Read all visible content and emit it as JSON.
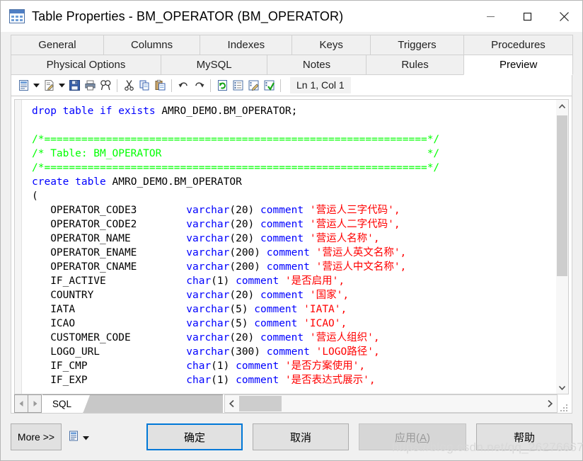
{
  "window": {
    "title": "Table Properties - BM_OPERATOR (BM_OPERATOR)",
    "icon": "table-icon",
    "controls": {
      "minimize": "minimize-icon",
      "maximize": "maximize-icon",
      "close": "close-icon"
    }
  },
  "tabs_row1": [
    {
      "label": "General",
      "active": false
    },
    {
      "label": "Columns",
      "active": false
    },
    {
      "label": "Indexes",
      "active": false
    },
    {
      "label": "Keys",
      "active": false
    },
    {
      "label": "Triggers",
      "active": false
    },
    {
      "label": "Procedures",
      "active": false
    }
  ],
  "tabs_row2": [
    {
      "label": "Physical Options",
      "active": false
    },
    {
      "label": "MySQL",
      "active": false
    },
    {
      "label": "Notes",
      "active": false
    },
    {
      "label": "Rules",
      "active": false
    },
    {
      "label": "Preview",
      "active": true
    }
  ],
  "toolbar": {
    "items": [
      {
        "name": "print-preview-icon",
        "type": "icon"
      },
      {
        "name": "print-preview-dropdown-icon",
        "type": "arrow"
      },
      {
        "name": "edit-document-icon",
        "type": "icon"
      },
      {
        "name": "edit-document-dropdown-icon",
        "type": "arrow"
      },
      {
        "name": "save-icon",
        "type": "icon"
      },
      {
        "name": "print-icon",
        "type": "icon"
      },
      {
        "name": "find-icon",
        "type": "icon"
      },
      {
        "name": "separator",
        "type": "sep"
      },
      {
        "name": "cut-icon",
        "type": "icon"
      },
      {
        "name": "copy-icon",
        "type": "icon"
      },
      {
        "name": "paste-icon",
        "type": "icon"
      },
      {
        "name": "separator",
        "type": "sep"
      },
      {
        "name": "undo-icon",
        "type": "icon"
      },
      {
        "name": "redo-icon",
        "type": "icon"
      },
      {
        "name": "separator",
        "type": "sep"
      },
      {
        "name": "refresh-icon",
        "type": "icon"
      },
      {
        "name": "list-view-icon",
        "type": "icon"
      },
      {
        "name": "edit-script-icon",
        "type": "icon"
      },
      {
        "name": "validate-script-icon",
        "type": "icon"
      },
      {
        "name": "separator",
        "type": "sep"
      }
    ],
    "cursor_position": "Ln 1, Col 1"
  },
  "editor": {
    "language": "SQL",
    "bottom_tab": "SQL",
    "nav_prev": "prev-sheet-icon",
    "nav_next": "next-sheet-icon",
    "code_lines": [
      [
        {
          "t": "drop table if exists ",
          "c": "k"
        },
        {
          "t": "AMRO_DEMO.BM_OPERATOR;",
          "c": "id"
        }
      ],
      [],
      [
        {
          "t": "/*==============================================================*/",
          "c": "cm"
        }
      ],
      [
        {
          "t": "/* Table: BM_OPERATOR                                           */",
          "c": "cm"
        }
      ],
      [
        {
          "t": "/*==============================================================*/",
          "c": "cm"
        }
      ],
      [
        {
          "t": "create table ",
          "c": "k"
        },
        {
          "t": "AMRO_DEMO.BM_OPERATOR",
          "c": "id"
        }
      ],
      [
        {
          "t": "(",
          "c": "id"
        }
      ],
      [
        {
          "t": "   OPERATOR_CODE3        ",
          "c": "id"
        },
        {
          "t": "varchar",
          "c": "k"
        },
        {
          "t": "(20) ",
          "c": "id"
        },
        {
          "t": "comment ",
          "c": "k"
        },
        {
          "t": "'营运人三字代码',",
          "c": "str"
        }
      ],
      [
        {
          "t": "   OPERATOR_CODE2        ",
          "c": "id"
        },
        {
          "t": "varchar",
          "c": "k"
        },
        {
          "t": "(20) ",
          "c": "id"
        },
        {
          "t": "comment ",
          "c": "k"
        },
        {
          "t": "'营运人二字代码',",
          "c": "str"
        }
      ],
      [
        {
          "t": "   OPERATOR_NAME         ",
          "c": "id"
        },
        {
          "t": "varchar",
          "c": "k"
        },
        {
          "t": "(20) ",
          "c": "id"
        },
        {
          "t": "comment ",
          "c": "k"
        },
        {
          "t": "'营运人名称',",
          "c": "str"
        }
      ],
      [
        {
          "t": "   OPERATOR_ENAME        ",
          "c": "id"
        },
        {
          "t": "varchar",
          "c": "k"
        },
        {
          "t": "(200) ",
          "c": "id"
        },
        {
          "t": "comment ",
          "c": "k"
        },
        {
          "t": "'营运人英文名称',",
          "c": "str"
        }
      ],
      [
        {
          "t": "   OPERATOR_CNAME        ",
          "c": "id"
        },
        {
          "t": "varchar",
          "c": "k"
        },
        {
          "t": "(200) ",
          "c": "id"
        },
        {
          "t": "comment ",
          "c": "k"
        },
        {
          "t": "'营运人中文名称',",
          "c": "str"
        }
      ],
      [
        {
          "t": "   IF_ACTIVE             ",
          "c": "id"
        },
        {
          "t": "char",
          "c": "k"
        },
        {
          "t": "(1) ",
          "c": "id"
        },
        {
          "t": "comment ",
          "c": "k"
        },
        {
          "t": "'是否启用',",
          "c": "str"
        }
      ],
      [
        {
          "t": "   COUNTRY               ",
          "c": "id"
        },
        {
          "t": "varchar",
          "c": "k"
        },
        {
          "t": "(20) ",
          "c": "id"
        },
        {
          "t": "comment ",
          "c": "k"
        },
        {
          "t": "'国家',",
          "c": "str"
        }
      ],
      [
        {
          "t": "   IATA                  ",
          "c": "id"
        },
        {
          "t": "varchar",
          "c": "k"
        },
        {
          "t": "(5) ",
          "c": "id"
        },
        {
          "t": "comment ",
          "c": "k"
        },
        {
          "t": "'IATA',",
          "c": "str"
        }
      ],
      [
        {
          "t": "   ICAO                  ",
          "c": "id"
        },
        {
          "t": "varchar",
          "c": "k"
        },
        {
          "t": "(5) ",
          "c": "id"
        },
        {
          "t": "comment ",
          "c": "k"
        },
        {
          "t": "'ICAO',",
          "c": "str"
        }
      ],
      [
        {
          "t": "   CUSTOMER_CODE         ",
          "c": "id"
        },
        {
          "t": "varchar",
          "c": "k"
        },
        {
          "t": "(20) ",
          "c": "id"
        },
        {
          "t": "comment ",
          "c": "k"
        },
        {
          "t": "'营运人组织',",
          "c": "str"
        }
      ],
      [
        {
          "t": "   LOGO_URL              ",
          "c": "id"
        },
        {
          "t": "varchar",
          "c": "k"
        },
        {
          "t": "(300) ",
          "c": "id"
        },
        {
          "t": "comment ",
          "c": "k"
        },
        {
          "t": "'LOGO路径',",
          "c": "str"
        }
      ],
      [
        {
          "t": "   IF_CMP                ",
          "c": "id"
        },
        {
          "t": "char",
          "c": "k"
        },
        {
          "t": "(1) ",
          "c": "id"
        },
        {
          "t": "comment ",
          "c": "k"
        },
        {
          "t": "'是否方案使用',",
          "c": "str"
        }
      ],
      [
        {
          "t": "   IF_EXP                ",
          "c": "id"
        },
        {
          "t": "char",
          "c": "k"
        },
        {
          "t": "(1) ",
          "c": "id"
        },
        {
          "t": "comment ",
          "c": "k"
        },
        {
          "t": "'是否表达式展示',",
          "c": "str"
        }
      ]
    ]
  },
  "footer": {
    "more_label": "More >>",
    "options_icon": "script-options-icon",
    "options_dropdown_icon": "chevron-down-icon",
    "ok_label": "确定",
    "cancel_label": "取消",
    "apply_label": "应用(A)",
    "apply_accelerator": "A",
    "help_label": "帮助",
    "watermark": "https://blog.csdn.net/qq_26276667"
  },
  "colors": {
    "accent": "#0078d7",
    "keyword": "#0000ff",
    "comment": "#00ff00",
    "string": "#ff0000",
    "window_bg": "#f0f0f0",
    "editor_bg": "#ffffff"
  }
}
